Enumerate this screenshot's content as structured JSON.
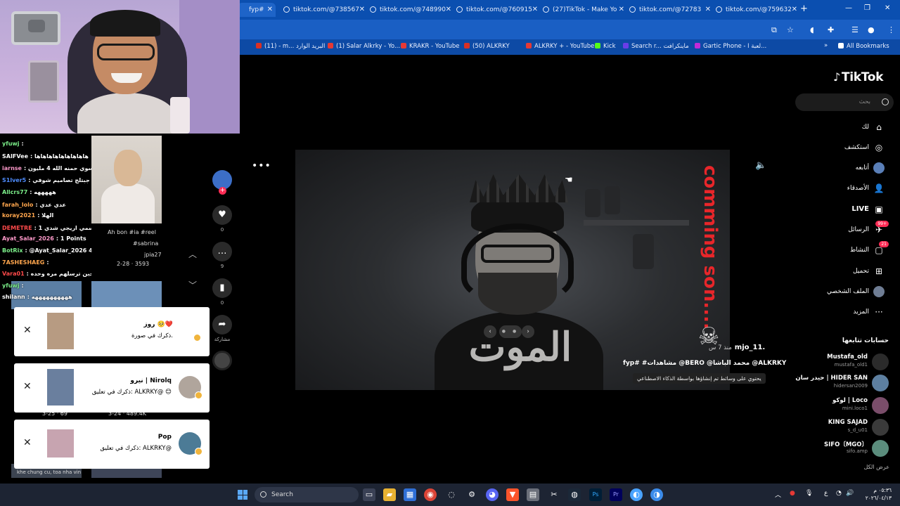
{
  "browser": {
    "tabs": [
      {
        "label": "fyp#"
      },
      {
        "label": "tiktok.com/@738567"
      },
      {
        "label": "tiktok.com/@748990"
      },
      {
        "label": "tiktok.com/@760915"
      },
      {
        "label": "(27)TikTok - Make Yo"
      },
      {
        "label": "tiktok.com/@72783"
      },
      {
        "label": "tiktok.com/@759632"
      }
    ],
    "new_tab": "+",
    "bookmarks": [
      {
        "label": "(11) - m... البريد الوارد"
      },
      {
        "label": "(1) Salar Alkrky - Yo..."
      },
      {
        "label": "KRAKR - YouTube"
      },
      {
        "label": "(50) ALKRKY"
      },
      {
        "label": "ALKRKY + - YouTube"
      },
      {
        "label": "Kick"
      },
      {
        "label": "Search r... ماينكرافت"
      },
      {
        "label": "Gartic Phone - لعبة ا..."
      },
      {
        "label": "All Bookmarks"
      }
    ]
  },
  "tiktok": {
    "logo": "TikTok",
    "search_placeholder": "بحث",
    "nav": [
      {
        "label": "لك",
        "icon": "home-icon"
      },
      {
        "label": "استكشف",
        "icon": "compass-icon"
      },
      {
        "label": "أتابعه",
        "icon": "following-icon"
      },
      {
        "label": "الأصدقاء",
        "icon": "friends-icon"
      },
      {
        "label": "LIVE",
        "icon": "live-icon"
      },
      {
        "label": "الرسائل",
        "icon": "messages-icon",
        "badge": "99+"
      },
      {
        "label": "النشاط",
        "icon": "activity-icon",
        "badge": "21"
      },
      {
        "label": "تحميل",
        "icon": "upload-icon"
      },
      {
        "label": "الملف الشخصي",
        "icon": "profile-icon"
      },
      {
        "label": "المزيد",
        "icon": "more-icon"
      }
    ],
    "following_title": "حسابات تتابعها",
    "following": [
      {
        "name": "Mustafa_old",
        "username": "mustafa_old1"
      },
      {
        "name": "حيدر سان | HIDER SAN",
        "username": "hidersan2009"
      },
      {
        "name": "لوكو | Loco",
        "username": "mini.loco1"
      },
      {
        "name": "KING SAJAD",
        "username": "s_d_u01"
      },
      {
        "name": "SIFO〔MGO〕",
        "username": "sifo.amp"
      }
    ],
    "show_all": "عرض الكل"
  },
  "video": {
    "overlay_text_vertical": "comming son....",
    "overlay_text_arabic": "الموت",
    "author": "mjo_11.",
    "posted": "منذ 7 س",
    "caption": "fyp# #مشاهدات @BERO @محمد الباشا @ALKRKY",
    "ai_label": "يحتوي على وسائط تم إنشاؤها بواسطة الذكاء الاصطناعي",
    "actions": {
      "likes": "0",
      "comments": "9",
      "saves": "0",
      "share_label": "مشاركة"
    }
  },
  "chat": [
    {
      "user": "yfuwj",
      "msg": ":",
      "color": "#7cf08a"
    },
    {
      "user": "SAIFVee",
      "msg": ": هاهاهاهاهاهاهاهاها",
      "color": "#ffffff"
    },
    {
      "user": "iarnse",
      "msg": ": ويعد هم تسوي حمنه الله 4 مليون",
      "color": "#ff9acb"
    },
    {
      "user": "S1lver5",
      "msg": ": جبتلج تصاميم شوفي",
      "color": "#4f8dff"
    },
    {
      "user": "Allcrs77",
      "msg": ": هههههه",
      "color": "#7cf08a"
    },
    {
      "user": "farah_lolo",
      "msg": ": عدي عدي",
      "color": "#ffa64d"
    },
    {
      "user": "koray2021",
      "msg": ": الهلا",
      "color": "#ffa64d"
    },
    {
      "user": "DEMETRE",
      "msg": ": اسمي اريجي شدي 1 DEMTRE CR",
      "color": "#ff4a4a"
    },
    {
      "user": "Ayat_Salar_2026",
      "msg": ": 1 Points",
      "color": "#ff9acb"
    },
    {
      "user": "BotRix",
      "msg": ": @Ayat_Salar_2026 لديه نقاط 460",
      "color": "#7cf08a"
    },
    {
      "user": "7ASHESHAEG",
      "msg": ":",
      "color": "#ffa64d"
    },
    {
      "user": "Vara01",
      "msg": ": يلا نجمع المتابعين يم سالار و يعجبن ترسلهم مره وحده",
      "color": "#ff4a4a"
    },
    {
      "user": "yfuwj",
      "msg": ":",
      "color": "#7cf08a"
    },
    {
      "user": "shilann",
      "msg": ": ههههههههههه",
      "color": "#ffffff"
    }
  ],
  "background_fragments": {
    "reel_caption": "Ah bon #ia #reel",
    "hashtag": "#sabrina",
    "handle": "jpia27",
    "stats_1": "2-28 · 3593",
    "stats_2": "3-25 · 69",
    "stats_3": "3-24 · 489.4K",
    "bottom_text": "khe chung cu, toa nha vin"
  },
  "notifications": [
    {
      "title": "روز 🥺❤️",
      "message": "ذكرك في صورة."
    },
    {
      "title": "نيرو | Nirolq",
      "message": "ذكرك في تعليق: ALKRKY@ 😊"
    },
    {
      "title": "Pop",
      "message": "ذكرك في تعليق: ALKRKY@"
    }
  ],
  "taskbar": {
    "search": "Search",
    "time": "٠٥:٣٦ م",
    "date": "٢٠٢٦/٠٤/١٣"
  }
}
